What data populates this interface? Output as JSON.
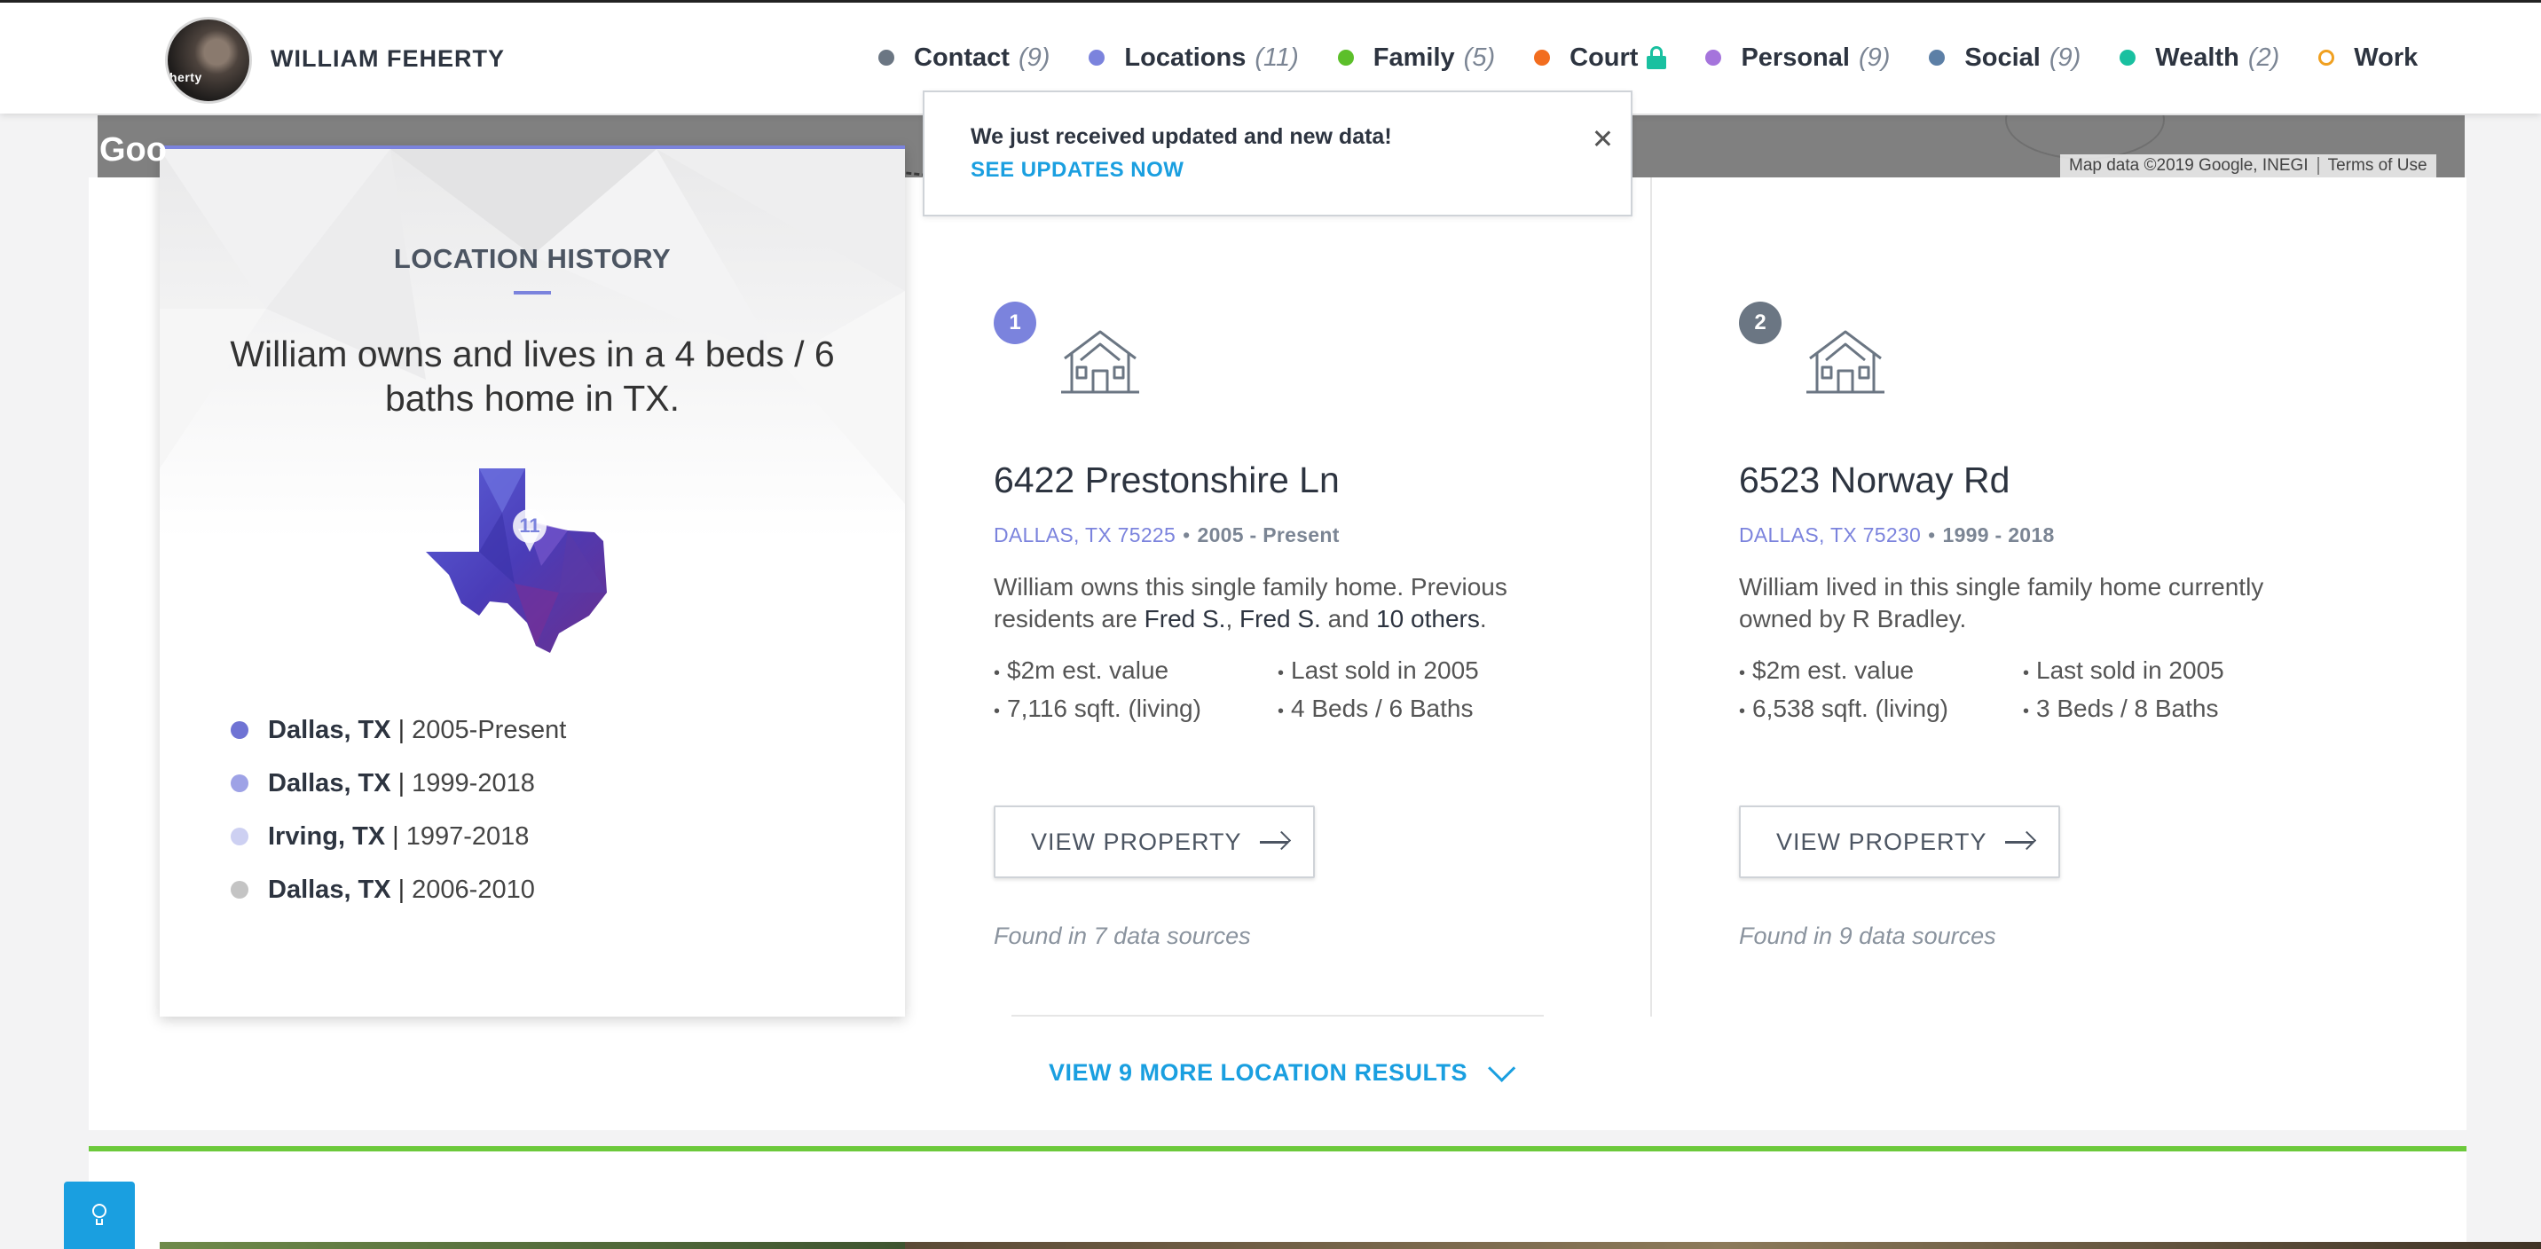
{
  "header": {
    "avatar_text": "herty",
    "person_name": "WILLIAM FEHERTY",
    "nav": [
      {
        "label": "Contact",
        "count": "(9)",
        "color": "#6b7683"
      },
      {
        "label": "Locations",
        "count": "(11)",
        "color": "#7b83dd"
      },
      {
        "label": "Family",
        "count": "(5)",
        "color": "#5cbf2a"
      },
      {
        "label": "Court",
        "count": "",
        "color": "#f26d1f",
        "locked": true
      },
      {
        "label": "Personal",
        "count": "(9)",
        "color": "#a574dc"
      },
      {
        "label": "Social",
        "count": "(9)",
        "color": "#5c7fa6"
      },
      {
        "label": "Wealth",
        "count": "(2)",
        "color": "#19c0a0"
      },
      {
        "label": "Work",
        "count": "",
        "color": "#f0a020"
      }
    ]
  },
  "map": {
    "google_logo": "Goo",
    "attribution": "Map data ©2019 Google, INEGI",
    "terms": "Terms of Use"
  },
  "toast": {
    "message": "We just received updated and new data!",
    "link": "SEE UPDATES NOW"
  },
  "history": {
    "title": "LOCATION HISTORY",
    "summary": "William owns and lives in a 4 beds / 6 baths home in TX.",
    "map_pin_count": "11",
    "items": [
      {
        "city": "Dallas, TX",
        "years": "2005-Present",
        "color": "#6f73d4"
      },
      {
        "city": "Dallas, TX",
        "years": "1999-2018",
        "color": "#9ea2e6"
      },
      {
        "city": "Irving, TX",
        "years": "1997-2018",
        "color": "#cdd0f2"
      },
      {
        "city": "Dallas, TX",
        "years": "2006-2010",
        "color": "#c4c4c4"
      }
    ]
  },
  "properties": [
    {
      "number": "1",
      "badge_color": "#7b83dd",
      "street": "6422 Prestonshire Ln",
      "city_zip": "DALLAS, TX 75225",
      "years": "2005 - Present",
      "desc_pre": "William owns this single family home. Previous residents are ",
      "desc_name1": "Fred S.",
      "desc_mid": ", ",
      "desc_name2": "Fred S.",
      "desc_and": " and ",
      "desc_others": "10 others",
      "desc_end": ".",
      "facts": [
        "$2m est. value",
        "Last sold in 2005",
        "7,116 sqft. (living)",
        "4 Beds / 6 Baths"
      ],
      "button": "VIEW PROPERTY",
      "sources": "Found in 7 data sources"
    },
    {
      "number": "2",
      "badge_color": "#6b7683",
      "street": "6523 Norway Rd",
      "city_zip": "DALLAS, TX 75230",
      "years": "1999 - 2018",
      "desc": "William lived in this single family home currently owned by R Bradley.",
      "facts": [
        "$2m est. value",
        "Last sold in 2005",
        "6,538 sqft. (living)",
        "3 Beds / 8 Baths"
      ],
      "button": "VIEW PROPERTY",
      "sources": "Found in 9 data sources"
    }
  ],
  "more_results": "VIEW 9 MORE LOCATION RESULTS"
}
